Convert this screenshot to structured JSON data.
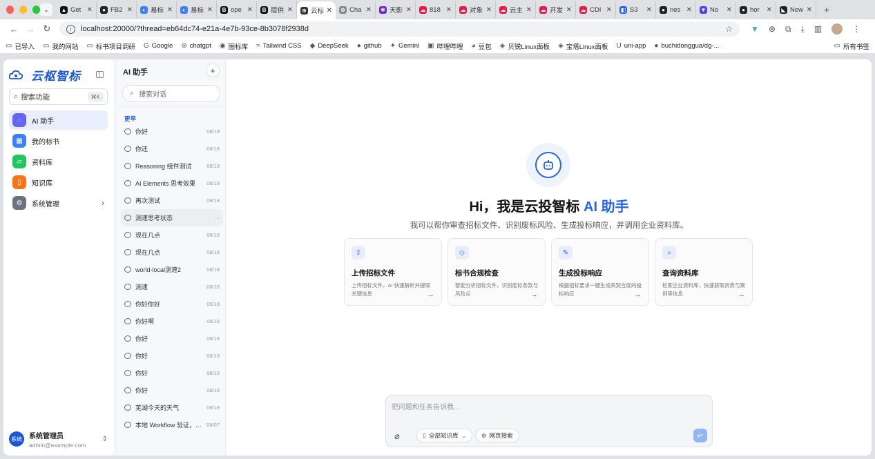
{
  "browser": {
    "tabs": [
      {
        "title": "Get",
        "color": "#111111",
        "glyph": "▲"
      },
      {
        "title": "FB2",
        "color": "#222222",
        "glyph": "●"
      },
      {
        "title": "易标",
        "color": "#3b82f6",
        "glyph": "◐"
      },
      {
        "title": "易标",
        "color": "#3b82f6",
        "glyph": "◐"
      },
      {
        "title": "ope",
        "color": "#111111",
        "glyph": "B"
      },
      {
        "title": "提供",
        "color": "#111111",
        "glyph": "B"
      },
      {
        "title": "云标",
        "color": "#333333",
        "glyph": "⊕",
        "active": true
      },
      {
        "title": "Cha",
        "color": "#888888",
        "glyph": "⊛"
      },
      {
        "title": "天影",
        "color": "#6d28d9",
        "glyph": "✱"
      },
      {
        "title": "818",
        "color": "#e11d48",
        "glyph": "☁"
      },
      {
        "title": "对象",
        "color": "#e11d48",
        "glyph": "☁"
      },
      {
        "title": "云主",
        "color": "#e11d48",
        "glyph": "☁"
      },
      {
        "title": "开发",
        "color": "#e11d48",
        "glyph": "☁"
      },
      {
        "title": "CDI",
        "color": "#e11d48",
        "glyph": "☁"
      },
      {
        "title": "S3",
        "color": "#2563eb",
        "glyph": "◧"
      },
      {
        "title": "nes",
        "color": "#222222",
        "glyph": "●"
      },
      {
        "title": "No",
        "color": "#4f46e5",
        "glyph": "▼"
      },
      {
        "title": "hor",
        "color": "#222222",
        "glyph": "●"
      },
      {
        "title": "New",
        "color": "#222222",
        "glyph": "◣"
      }
    ],
    "url": "localhost:20000/?thread=eb64dc74-e21a-4e7b-93ce-8b3078f2938d",
    "bookmarks": [
      {
        "label": "已导入",
        "icon": "▭"
      },
      {
        "label": "我的网站",
        "icon": "▭"
      },
      {
        "label": "标书项目调研",
        "icon": "▭"
      },
      {
        "label": "Google",
        "icon": "G"
      },
      {
        "label": "chatgpt",
        "icon": "⊛"
      },
      {
        "label": "图标库",
        "icon": "◉"
      },
      {
        "label": "Tailwind CSS",
        "icon": "≈"
      },
      {
        "label": "DeepSeek",
        "icon": "◆"
      },
      {
        "label": "github",
        "icon": "●"
      },
      {
        "label": "Gemini",
        "icon": "✦"
      },
      {
        "label": "哔哩哔哩",
        "icon": "▣"
      },
      {
        "label": "豆包",
        "icon": "◕"
      },
      {
        "label": "贝锐Linux面板",
        "icon": "◈"
      },
      {
        "label": "宝塔Linux面板",
        "icon": "◈"
      },
      {
        "label": "uni-app",
        "icon": "U"
      },
      {
        "label": "buchidonggua/dg-...",
        "icon": "●"
      }
    ],
    "bookmarks_right": "所有书签"
  },
  "sidebar": {
    "brand": "云枢智标",
    "search_placeholder": "搜索功能",
    "search_kbd": "⌘K",
    "nav": [
      {
        "label": "AI 助手",
        "color": "#6366f1",
        "icon": "◌",
        "active": true
      },
      {
        "label": "我的标书",
        "color": "#3b82f6",
        "icon": "▦"
      },
      {
        "label": "资料库",
        "color": "#22c55e",
        "icon": "▱"
      },
      {
        "label": "知识库",
        "color": "#f97316",
        "icon": "▯"
      },
      {
        "label": "系统管理",
        "color": "#6b7280",
        "icon": "⚙",
        "chevron": "›"
      }
    ],
    "user": {
      "avatar": "系统",
      "name": "系统管理员",
      "email": "admin@example.com"
    }
  },
  "threads": {
    "title": "AI 助手",
    "search_placeholder": "搜索对话",
    "group": "更早",
    "items": [
      {
        "title": "你好",
        "date": "08/19"
      },
      {
        "title": "你还",
        "date": "08/18"
      },
      {
        "title": "Reasoning 组件测试",
        "date": "08/18"
      },
      {
        "title": "AI Elements 思考效果",
        "date": "08/18"
      },
      {
        "title": "再次测试",
        "date": "08/18"
      },
      {
        "title": "测速思考状态",
        "date": "···",
        "active": true
      },
      {
        "title": "现在几点",
        "date": "08/18"
      },
      {
        "title": "现在几点",
        "date": "08/18"
      },
      {
        "title": "world-local测速2",
        "date": "08/18"
      },
      {
        "title": "测速",
        "date": "08/18"
      },
      {
        "title": "你好你好",
        "date": "08/18"
      },
      {
        "title": "你好啊",
        "date": "08/18"
      },
      {
        "title": "你好",
        "date": "08/18"
      },
      {
        "title": "你好",
        "date": "08/18"
      },
      {
        "title": "你好",
        "date": "08/18"
      },
      {
        "title": "你好",
        "date": "08/18"
      },
      {
        "title": "芜湖今天的天气",
        "date": "08/18"
      },
      {
        "title": "本地 Workflow 验证，请...",
        "date": "08/07"
      }
    ]
  },
  "main": {
    "hero_title_prefix": "Hi，我是云投智标",
    "hero_title_accent": "AI 助手",
    "hero_subtitle": "我可以帮你审查招标文件、识别废标风险、生成投标响应，并调用企业资料库。",
    "cards": [
      {
        "icon": "⇪",
        "title": "上传招标文件",
        "desc": "上传招标文件，AI 快速解析并提取关键信息"
      },
      {
        "icon": "◇",
        "title": "标书合规检查",
        "desc": "智能分析招标文件，识别废标条款与风险点"
      },
      {
        "icon": "✎",
        "title": "生成投标响应",
        "desc": "根据招标要求一键生成高契合度的投标响应"
      },
      {
        "icon": "⌕",
        "title": "查询资料库",
        "desc": "检索企业资料库，快速获取资质与案例等信息"
      }
    ],
    "composer": {
      "placeholder": "把问题和任务告诉我...",
      "knowledge_chip": "全部知识库",
      "web_chip": "网页搜索"
    },
    "accent_color": "#2563eb"
  }
}
